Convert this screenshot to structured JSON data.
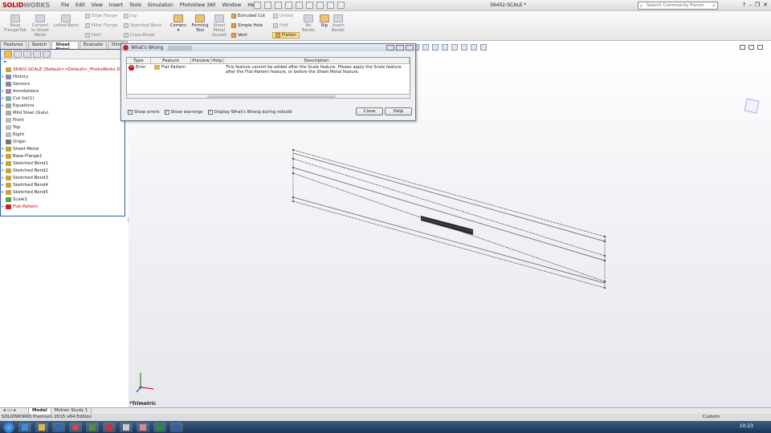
{
  "app": {
    "logo_main": "SOLID",
    "logo_rest": "WORKS",
    "menus": [
      "File",
      "Edit",
      "View",
      "Insert",
      "Tools",
      "Simulation",
      "PhotoView 360",
      "Window",
      "Help"
    ],
    "doc_title": "36402-SCALE *",
    "search_placeholder": "Search Community Forum"
  },
  "command_manager": {
    "big": [
      {
        "label1": "Base",
        "label2": "Flange/Tab"
      },
      {
        "label1": "Convert",
        "label2": "to Sheet",
        "label3": "Metal"
      },
      {
        "label1": "Lofted-Bend",
        "label2": ""
      },
      {
        "label1": "Corners",
        "label2": ""
      },
      {
        "label1": "Forming",
        "label2": "Tool"
      },
      {
        "label1": "Sheet",
        "label2": "Metal",
        "label3": "Gusset"
      },
      {
        "label1": "No",
        "label2": "Bends"
      },
      {
        "label1": "Rip",
        "label2": ""
      },
      {
        "label1": "Insert",
        "label2": "Bends"
      }
    ],
    "small_col1": [
      "Edge Flange",
      "Miter Flange",
      "Hem"
    ],
    "small_col2": [
      "Jog",
      "Sketched Bend",
      "Cross-Break"
    ],
    "small_col3": [
      "Extruded Cut",
      "Simple Hole",
      "Vent"
    ],
    "small_col4": [
      "Unfold",
      "Fold",
      "Flatten"
    ]
  },
  "tabs": [
    "Features",
    "Sketch",
    "Sheet Metal",
    "Evaluate",
    "DimX"
  ],
  "tree": {
    "filter_icon": "funnel-icon",
    "root": "36402-SCALE  (Default<<Default>_PhotoWorks D",
    "items": [
      {
        "label": "History",
        "exp": "+"
      },
      {
        "label": "Sensors",
        "exp": ""
      },
      {
        "label": "Annotations",
        "exp": "+"
      },
      {
        "label": "Cut list(1)",
        "exp": "+"
      },
      {
        "label": "Equations",
        "exp": "+"
      },
      {
        "label": "Mild Steel (Galv)",
        "exp": ""
      },
      {
        "label": "Front",
        "exp": ""
      },
      {
        "label": "Top",
        "exp": ""
      },
      {
        "label": "Right",
        "exp": ""
      },
      {
        "label": "Origin",
        "exp": ""
      },
      {
        "label": "Sheet-Metal",
        "exp": "+"
      },
      {
        "label": "Base-Flange1",
        "exp": "+"
      },
      {
        "label": "Sketched Bend1",
        "exp": "+"
      },
      {
        "label": "Sketched Bend2",
        "exp": "+"
      },
      {
        "label": "Sketched Bend3",
        "exp": "+"
      },
      {
        "label": "Sketched Bend4",
        "exp": "+"
      },
      {
        "label": "Sketched Bend5",
        "exp": "+"
      },
      {
        "label": "Scale1",
        "exp": ""
      },
      {
        "label": "Flat-Pattern",
        "exp": "+"
      }
    ]
  },
  "dialog": {
    "title": "What's Wrong",
    "columns": [
      "Type",
      "Feature",
      "Preview",
      "Help",
      "Description"
    ],
    "row": {
      "type": "Error",
      "feature": "Flat-Pattern",
      "description": "This feature cannot be added after the Scale feature. Please apply the Scale feature after the Flat-Pattern feature, or before the Sheet Metal feature."
    },
    "checks": [
      "Show errors",
      "Show warnings",
      "Display What's Wrong during rebuild"
    ],
    "close": "Close",
    "help": "Help"
  },
  "viewport": {
    "view_label": "*Trimetric"
  },
  "bottom_tabs": [
    "Model",
    "Motion Study 1"
  ],
  "status": {
    "text": "SOLIDWORKS Premium 2015 x64 Edition",
    "units": "Custom"
  },
  "taskbar": {
    "clock": "10:23"
  },
  "colors": {
    "error": "#cc0000",
    "tree_border": "#2a5db0",
    "accent": "#e6a33a"
  }
}
